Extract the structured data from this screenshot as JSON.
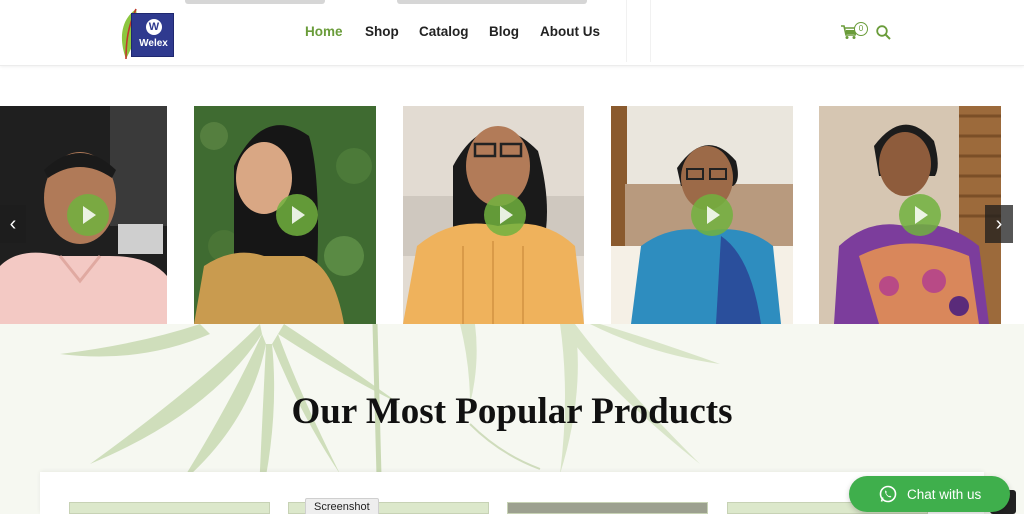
{
  "brand": {
    "logo_letter": "W",
    "logo_word": "Welex"
  },
  "nav": {
    "items": [
      {
        "label": "Home",
        "active": true
      },
      {
        "label": "Shop",
        "active": false
      },
      {
        "label": "Catalog",
        "active": false
      },
      {
        "label": "Blog",
        "active": false
      },
      {
        "label": "About Us",
        "active": false
      }
    ]
  },
  "header_icons": {
    "cart": "cart-icon",
    "cart_count": "0",
    "search": "search-icon"
  },
  "carousel": {
    "videos": [
      {
        "icon": "play-icon"
      },
      {
        "icon": "play-icon"
      },
      {
        "icon": "play-icon"
      },
      {
        "icon": "play-icon"
      },
      {
        "icon": "play-icon"
      }
    ],
    "prev_label": "‹",
    "next_label": "›"
  },
  "products": {
    "title": "Our Most Popular Products"
  },
  "tooltip": {
    "label": "Screenshot"
  },
  "chat": {
    "label": "Chat with us",
    "icon": "whatsapp-icon"
  },
  "colors": {
    "accent": "#6a9c3a",
    "chat": "#3faf4c",
    "logo_bg": "#2f3a8f"
  }
}
